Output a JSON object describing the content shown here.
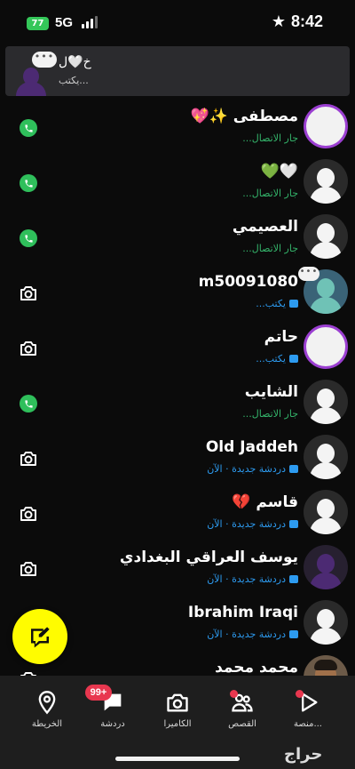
{
  "status_bar": {
    "battery": "77",
    "network": "5G",
    "time": "8:42"
  },
  "banner": {
    "name": "خ🤍ل",
    "subtitle": "يكتب..."
  },
  "chats": [
    {
      "name": "مصطفى ✨💖",
      "status": "جار الاتصال...",
      "status_type": "calling",
      "action": "call",
      "avatar": "ring"
    },
    {
      "name": "🤍💚",
      "status": "جار الاتصال...",
      "status_type": "calling",
      "action": "call",
      "avatar": "ghost"
    },
    {
      "name": "العصيمي",
      "status": "جار الاتصال...",
      "status_type": "calling",
      "action": "call",
      "avatar": "ghost"
    },
    {
      "name": "m50091080",
      "status": "يكتب...",
      "status_type": "typing",
      "action": "camera",
      "avatar": "blue"
    },
    {
      "name": "حاتم",
      "status": "يكتب...",
      "status_type": "typing",
      "action": "camera",
      "avatar": "ring"
    },
    {
      "name": "الشايب",
      "status": "جار الاتصال...",
      "status_type": "calling",
      "action": "call",
      "avatar": "ghost"
    },
    {
      "name": "Old Jaddeh",
      "status": "دردشة جديدة · الآن",
      "status_type": "new",
      "action": "camera",
      "avatar": "ghost"
    },
    {
      "name": "قاسم 💔",
      "status": "دردشة جديدة · الآن",
      "status_type": "new",
      "action": "camera",
      "avatar": "ghost"
    },
    {
      "name": "يوسف العراقي البغدادي",
      "status": "دردشة جديدة · الآن",
      "status_type": "new",
      "action": "camera",
      "avatar": "purple"
    },
    {
      "name": "Ibrahim Iraqi",
      "status": "دردشة جديدة · الآن",
      "status_type": "new",
      "action": "camera",
      "avatar": "ghost"
    },
    {
      "name": "محمد محمد",
      "status": "",
      "status_type": "new",
      "action": "camera",
      "avatar": "photo"
    }
  ],
  "nav": {
    "map_label": "الخريطة",
    "chat_label": "دردشة",
    "chat_badge": "99+",
    "camera_label": "الكاميرا",
    "stories_label": "القصص",
    "spotlight_label": "منصة..."
  },
  "watermark": "حراج",
  "colors": {
    "accent_yellow": "#fffc00",
    "calling_green": "#34b56b",
    "new_blue": "#2d9bf0",
    "badge_red": "#e8374f",
    "ring_purple": "#9b3fd1"
  }
}
